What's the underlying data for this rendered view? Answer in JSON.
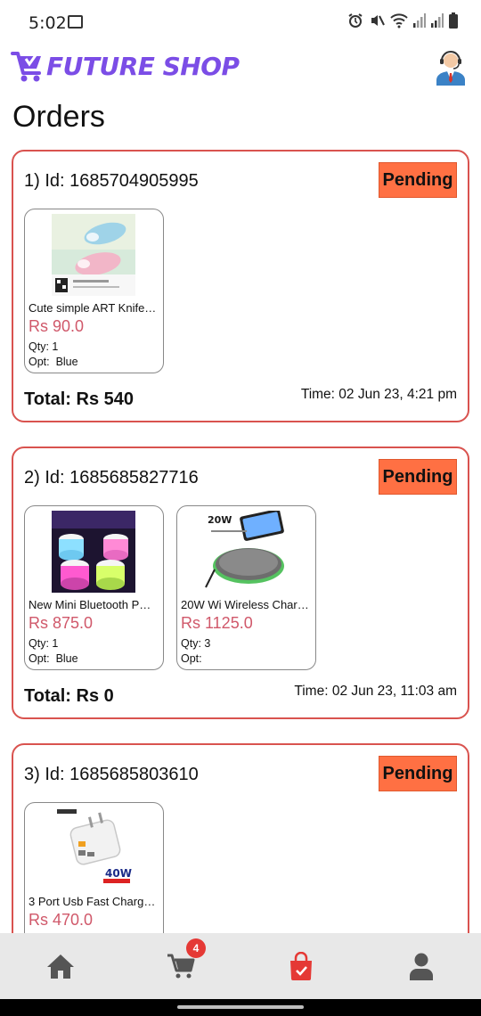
{
  "status_bar": {
    "time": "5:02",
    "icons": [
      "image-icon",
      "alarm-icon",
      "mute-icon",
      "wifi-icon",
      "signal-icon",
      "signal-icon",
      "battery-icon"
    ]
  },
  "header": {
    "logo_text": "FUTURE SHOP",
    "logo_color": "#7b4de6",
    "avatar_icon": "support-agent-icon"
  },
  "page_title": "Orders",
  "colors": {
    "card_border": "#d9534f",
    "badge_bg": "#ff7043",
    "price": "#d0586a",
    "nav_active": "#e53935"
  },
  "orders": [
    {
      "id_label": "1) Id: 1685704905995",
      "status": "Pending",
      "items": [
        {
          "name": "Cute simple ART Knife…",
          "price": "Rs 90.0",
          "qty": "Qty: 1",
          "opt": "Opt:  Blue",
          "image_icon": "knife-product-image"
        }
      ],
      "total": "Total: Rs 540",
      "time": "Time: 02 Jun 23, 4:21 pm"
    },
    {
      "id_label": "2) Id: 1685685827716",
      "status": "Pending",
      "items": [
        {
          "name": "New Mini Bluetooth P…",
          "price": "Rs 875.0",
          "qty": "Qty: 1",
          "opt": "Opt:  Blue",
          "image_icon": "speaker-product-image"
        },
        {
          "name": "20W Wi Wireless Char…",
          "price": "Rs 1125.0",
          "qty": "Qty: 3",
          "opt": "Opt:",
          "image_icon": "charger-pad-product-image",
          "image_label": "20W"
        }
      ],
      "total": "Total: Rs 0",
      "time": "Time: 02 Jun 23, 11:03 am"
    },
    {
      "id_label": "3) Id: 1685685803610",
      "status": "Pending",
      "items": [
        {
          "name": "3 Port Usb Fast Charg…",
          "price": "Rs 470.0",
          "qty": "",
          "opt": "",
          "image_icon": "usb-charger-product-image",
          "image_label": "40W"
        }
      ],
      "total": "",
      "time": ""
    }
  ],
  "bottom_nav": {
    "items": [
      {
        "name": "home",
        "icon": "home-icon",
        "active": false
      },
      {
        "name": "cart",
        "icon": "cart-icon",
        "active": false,
        "badge": "4"
      },
      {
        "name": "orders",
        "icon": "shopping-bag-icon",
        "active": true
      },
      {
        "name": "profile",
        "icon": "person-icon",
        "active": false
      }
    ]
  }
}
